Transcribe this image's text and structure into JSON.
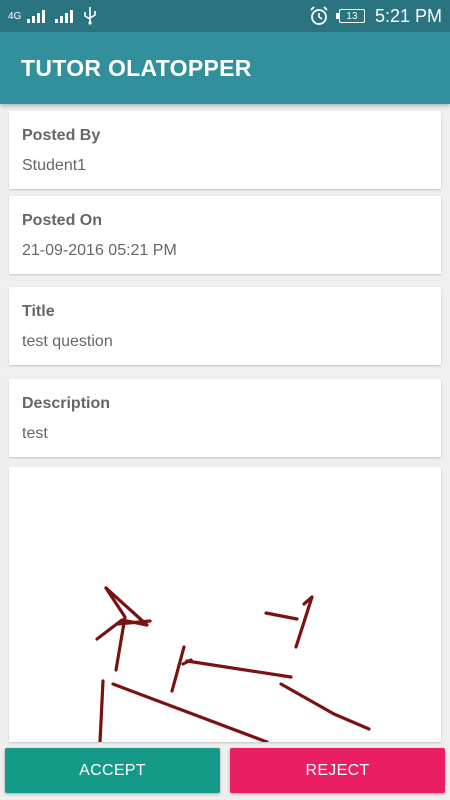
{
  "status_bar": {
    "network_label": "4G",
    "battery_level": "13",
    "time": "5:21 PM",
    "icons": [
      "signal-icon",
      "signal-icon",
      "usb-icon",
      "alarm-icon",
      "battery-icon"
    ]
  },
  "app_bar": {
    "title": "TUTOR OLATOPPER"
  },
  "fields": [
    {
      "label": "Posted By",
      "value": "Student1"
    },
    {
      "label": "Posted On",
      "value": "21-09-2016 05:21 PM"
    },
    {
      "label": "Title",
      "value": "test question"
    },
    {
      "label": "Description",
      "value": "test"
    }
  ],
  "actions": {
    "accept_label": "ACCEPT",
    "reject_label": "REJECT"
  },
  "colors": {
    "status_bar": "#2a7482",
    "app_bar": "#32909d",
    "accept": "#159a8a",
    "reject": "#e91e63",
    "ink": "#7a1212"
  }
}
